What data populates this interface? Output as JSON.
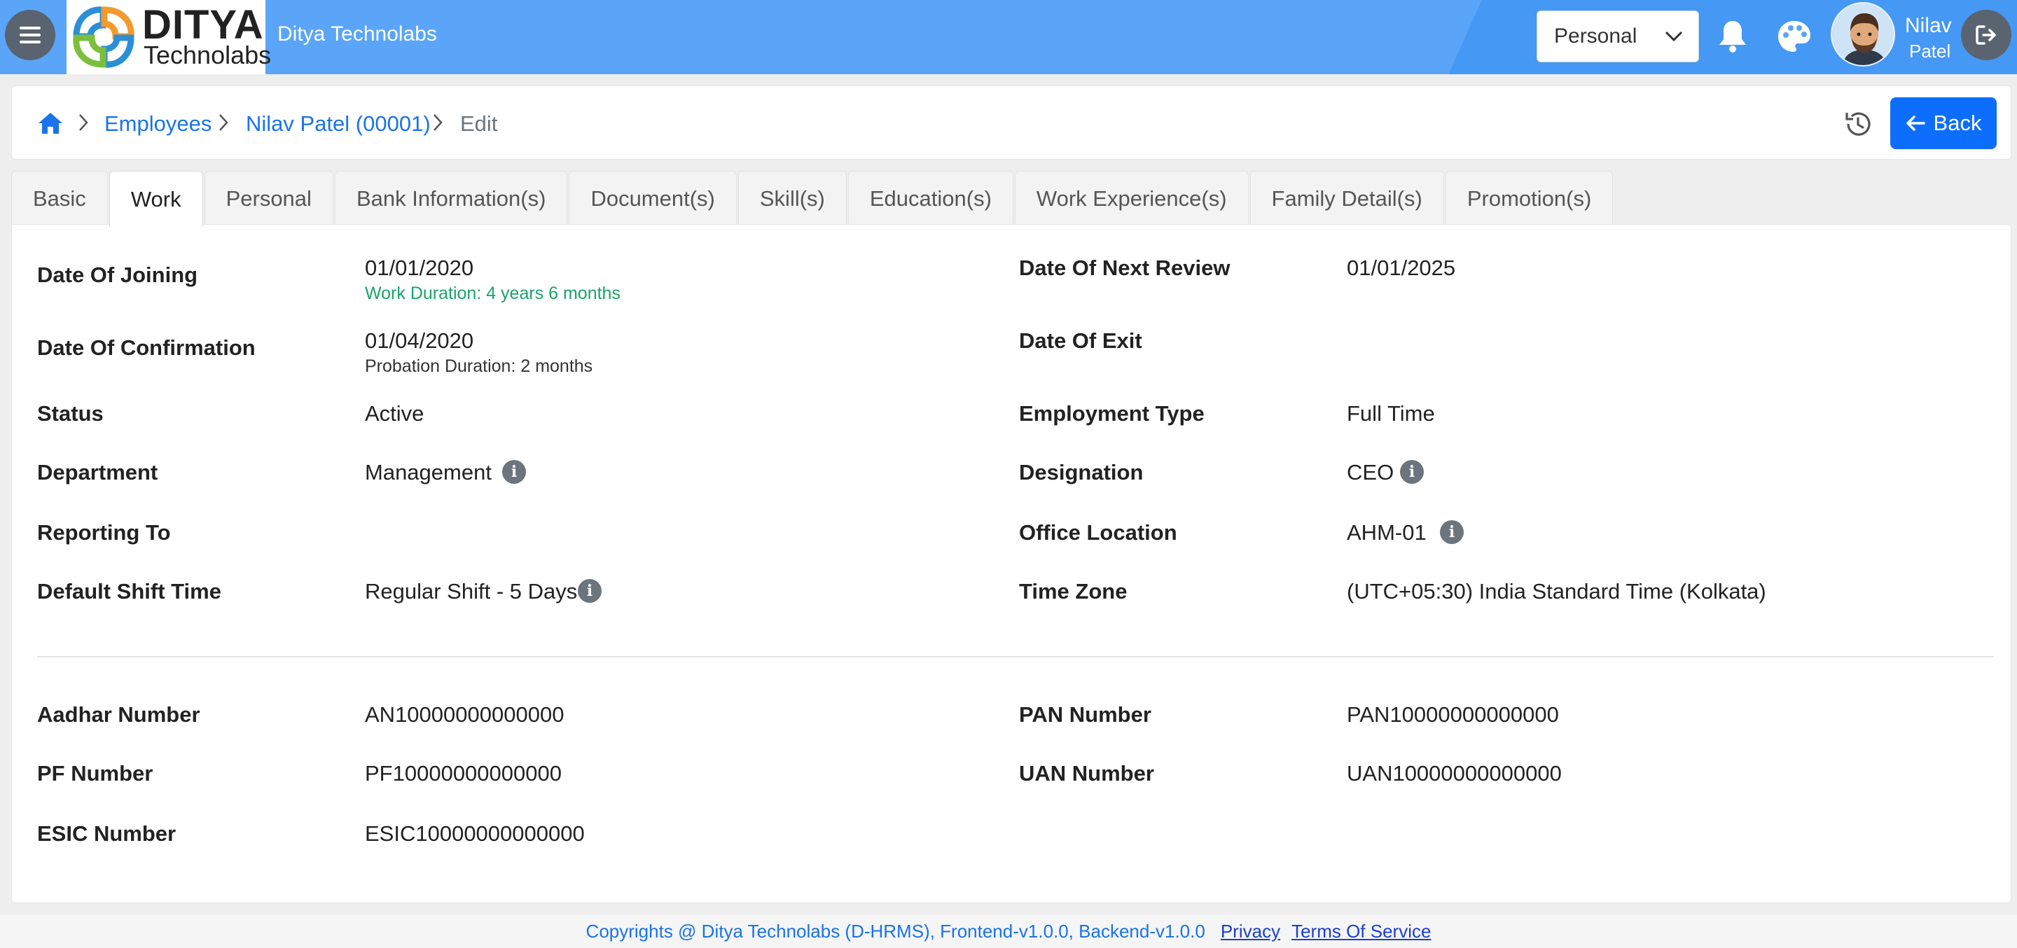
{
  "header": {
    "brand_line1": "DITYA",
    "brand_line2": "Technolabs",
    "brand_name": "Ditya Technolabs",
    "profile_select": {
      "value": "Personal"
    },
    "user": {
      "first_name": "Nilav",
      "last_name": "Patel"
    },
    "colors": {
      "topbar": "#5aa5f7",
      "accent": "#0d6efd"
    }
  },
  "breadcrumb": {
    "items": [
      "Employees",
      "Nilav Patel (00001)",
      "Edit"
    ],
    "back_label": "Back"
  },
  "tabs": [
    "Basic",
    "Work",
    "Personal",
    "Bank Information(s)",
    "Document(s)",
    "Skill(s)",
    "Education(s)",
    "Work Experience(s)",
    "Family Detail(s)",
    "Promotion(s)"
  ],
  "active_tab": "Work",
  "work": {
    "date_of_joining": {
      "label": "Date Of Joining",
      "value": "01/01/2020",
      "sub": "Work Duration: 4 years 6 months"
    },
    "date_of_next_review": {
      "label": "Date Of Next Review",
      "value": "01/01/2025"
    },
    "date_of_confirmation": {
      "label": "Date Of Confirmation",
      "value": "01/04/2020",
      "sub": "Probation Duration: 2 months"
    },
    "date_of_exit": {
      "label": "Date Of Exit",
      "value": ""
    },
    "status": {
      "label": "Status",
      "value": "Active"
    },
    "employment_type": {
      "label": "Employment Type",
      "value": "Full Time"
    },
    "department": {
      "label": "Department",
      "value": "Management"
    },
    "designation": {
      "label": "Designation",
      "value": "CEO"
    },
    "reporting_to": {
      "label": "Reporting To",
      "value": ""
    },
    "office_location": {
      "label": "Office Location",
      "value": "AHM-01"
    },
    "default_shift_time": {
      "label": "Default Shift Time",
      "value": "Regular Shift - 5 Days"
    },
    "time_zone": {
      "label": "Time Zone",
      "value": "(UTC+05:30) India Standard Time (Kolkata)"
    },
    "aadhar_number": {
      "label": "Aadhar Number",
      "value": "AN10000000000000"
    },
    "pan_number": {
      "label": "PAN Number",
      "value": "PAN10000000000000"
    },
    "pf_number": {
      "label": "PF Number",
      "value": "PF10000000000000"
    },
    "uan_number": {
      "label": "UAN Number",
      "value": "UAN10000000000000"
    },
    "esic_number": {
      "label": "ESIC Number",
      "value": "ESIC10000000000000"
    }
  },
  "footer": {
    "copyright": "Copyrights @ Ditya Technolabs (D-HRMS), Frontend-v1.0.0, Backend-v1.0.0",
    "privacy": "Privacy",
    "terms": "Terms Of Service"
  }
}
